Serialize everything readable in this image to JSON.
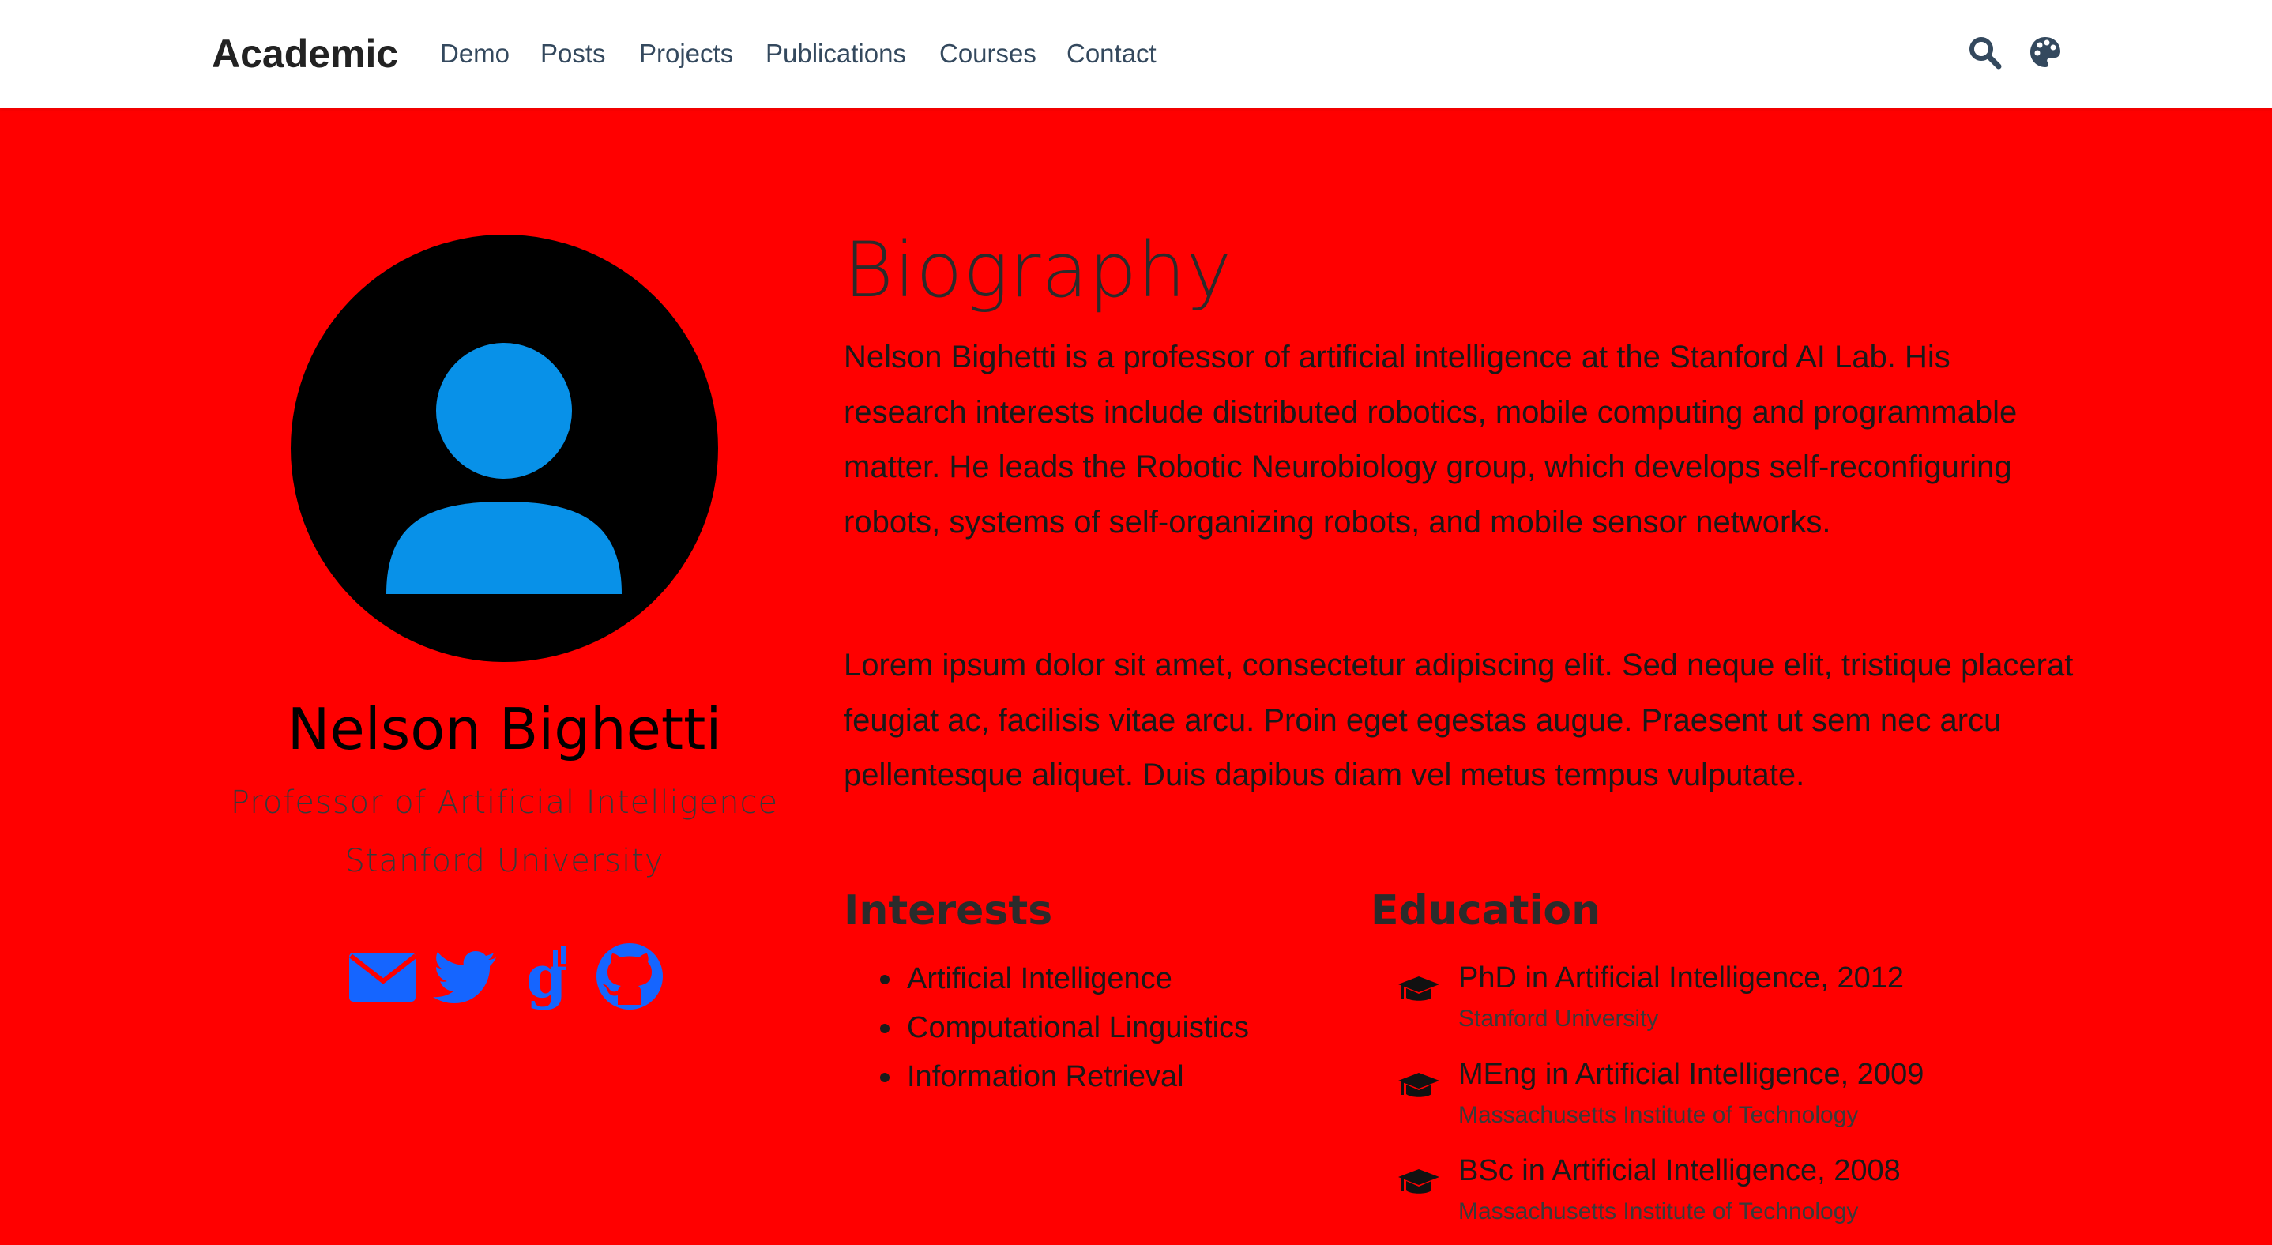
{
  "navbar": {
    "brand": "Academic",
    "links": [
      "Demo",
      "Posts",
      "Projects",
      "Publications",
      "Courses",
      "Contact"
    ],
    "icons": [
      "search-icon",
      "palette-icon"
    ]
  },
  "profile": {
    "name": "Nelson Bighetti",
    "role": "Professor of Artificial Intelligence",
    "organization": "Stanford University",
    "social_icons": [
      "envelope-icon",
      "twitter-icon",
      "google-scholar-icon",
      "github-icon"
    ]
  },
  "biography": {
    "title": "Biography",
    "paragraphs": [
      "Nelson Bighetti is a professor of artificial intelligence at the Stanford AI Lab. His research interests include distributed robotics, mobile computing and programmable matter. He leads the Robotic Neurobiology group, which develops self-reconfiguring robots, systems of self-organizing robots, and mobile sensor networks.",
      "Lorem ipsum dolor sit amet, consectetur adipiscing elit. Sed neque elit, tristique placerat feugiat ac, facilisis vitae arcu. Proin eget egestas augue. Praesent ut sem nec arcu pellentesque aliquet. Duis dapibus diam vel metus tempus vulputate."
    ]
  },
  "interests": {
    "heading": "Interests",
    "items": [
      "Artificial Intelligence",
      "Computational Linguistics",
      "Information Retrieval"
    ]
  },
  "education": {
    "heading": "Education",
    "items": [
      {
        "degree": "PhD in Artificial Intelligence, 2012",
        "institution": "Stanford University"
      },
      {
        "degree": "MEng in Artificial Intelligence, 2009",
        "institution": "Massachusetts Institute of Technology"
      },
      {
        "degree": "BSc in Artificial Intelligence, 2008",
        "institution": "Massachusetts Institute of Technology"
      }
    ]
  },
  "colors": {
    "page_background": "#ff0000",
    "navbar_background": "#ffffff",
    "icon_blue": "#1565ff",
    "avatar_blue": "#0891e8"
  }
}
